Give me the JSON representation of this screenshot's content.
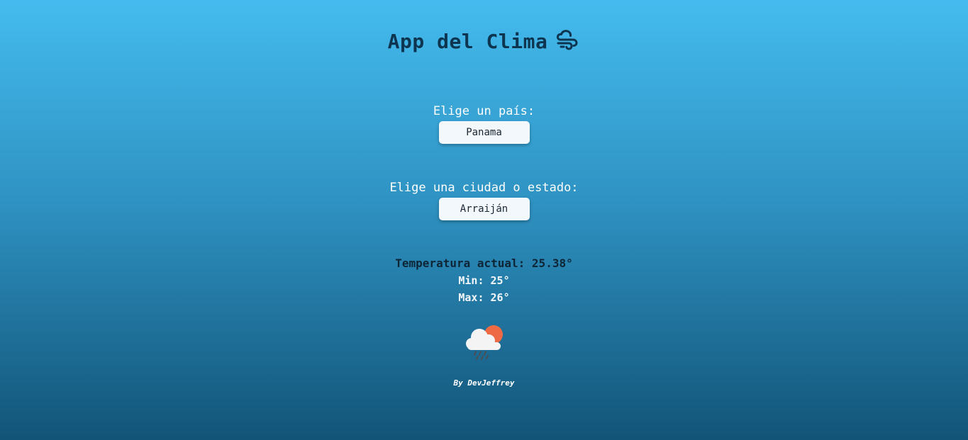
{
  "header": {
    "title": "App del Clima",
    "icon": "wind-cloud-icon",
    "title_color": "#0e3550"
  },
  "country": {
    "label": "Elige un país:",
    "selected": "Panama"
  },
  "city": {
    "label": "Elige una ciudad o estado:",
    "selected": "Arraiján"
  },
  "weather": {
    "current": "Temperatura actual: 25.38°",
    "min": "Min: 25°",
    "max": "Max: 26°",
    "icon": "sun-cloud-rain-icon"
  },
  "footer": {
    "credit": "By DevJeffrey"
  },
  "colors": {
    "bg_top": "#44bbee",
    "bg_bottom": "#125478",
    "sun": "#ee6a44"
  }
}
